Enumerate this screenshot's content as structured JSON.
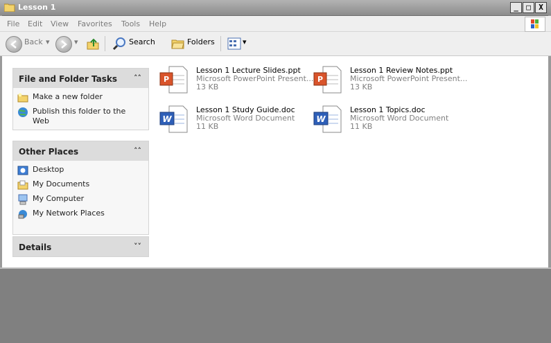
{
  "window": {
    "title": "Lesson 1",
    "controls": [
      "_",
      "□",
      "X"
    ]
  },
  "menubar": {
    "items": [
      "File",
      "Edit",
      "View",
      "Favorites",
      "Tools",
      "Help"
    ]
  },
  "toolbar": {
    "back_label": "Back",
    "search_label": "Search",
    "folders_label": "Folders"
  },
  "tasks": {
    "file_folder": {
      "title": "File and Folder Tasks",
      "items": [
        "Make a new folder",
        "Publish this folder to the Web"
      ]
    },
    "other_places": {
      "title": "Other Places",
      "items": [
        "Desktop",
        "My Documents",
        "My Computer",
        "My Network Places"
      ]
    },
    "details": {
      "title": "Details"
    }
  },
  "files": [
    {
      "name": "Lesson 1 Lecture Slides.ppt",
      "type": "Microsoft PowerPoint Present...",
      "size": "13 KB",
      "icon": "powerpoint-icon"
    },
    {
      "name": "Lesson 1 Review Notes.ppt",
      "type": "Microsoft PowerPoint Present...",
      "size": "13 KB",
      "icon": "powerpoint-icon"
    },
    {
      "name": "Lesson 1 Study Guide.doc",
      "type": "Microsoft Word Document",
      "size": "11 KB",
      "icon": "word-icon"
    },
    {
      "name": "Lesson 1 Topics.doc",
      "type": "Microsoft Word Document",
      "size": "11 KB",
      "icon": "word-icon"
    }
  ],
  "colors": {
    "titlebar": "#9a9a9a",
    "panel_header": "#dcdcdc",
    "bottom_area": "#808080"
  }
}
